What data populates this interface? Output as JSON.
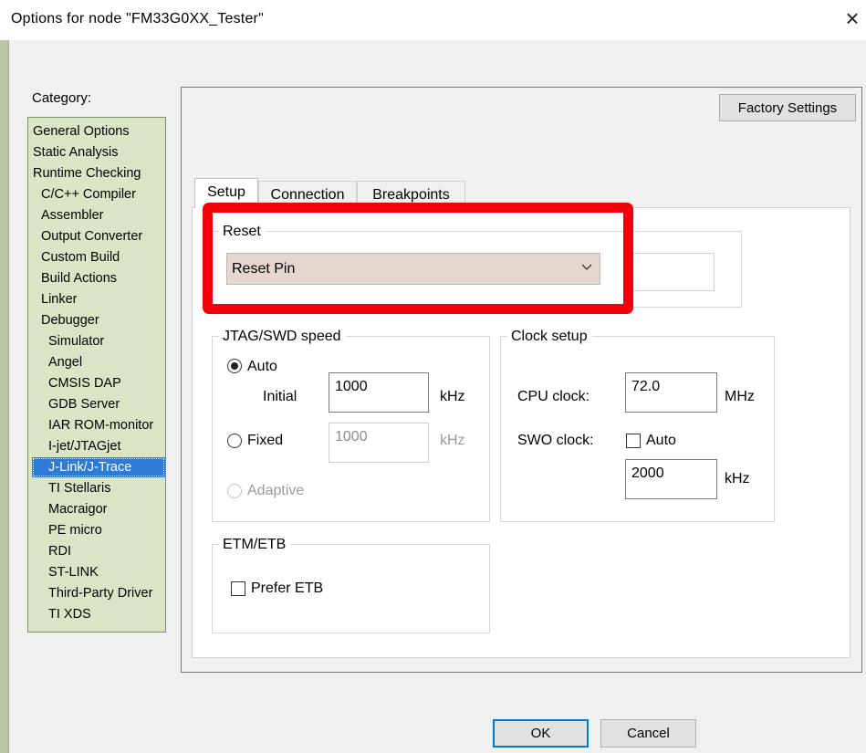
{
  "window": {
    "title": "Options for node \"FM33G0XX_Tester\"",
    "close_glyph": "×"
  },
  "category": {
    "label": "Category:",
    "items": [
      {
        "label": "General Options"
      },
      {
        "label": "Static Analysis"
      },
      {
        "label": "Runtime Checking"
      },
      {
        "label": "C/C++ Compiler"
      },
      {
        "label": "Assembler"
      },
      {
        "label": "Output Converter"
      },
      {
        "label": "Custom Build"
      },
      {
        "label": "Build Actions"
      },
      {
        "label": "Linker"
      },
      {
        "label": "Debugger"
      },
      {
        "label": "Simulator"
      },
      {
        "label": "Angel"
      },
      {
        "label": "CMSIS DAP"
      },
      {
        "label": "GDB Server"
      },
      {
        "label": "IAR ROM-monitor"
      },
      {
        "label": "I-jet/JTAGjet"
      },
      {
        "label": "J-Link/J-Trace"
      },
      {
        "label": "TI Stellaris"
      },
      {
        "label": "Macraigor"
      },
      {
        "label": "PE micro"
      },
      {
        "label": "RDI"
      },
      {
        "label": "ST-LINK"
      },
      {
        "label": "Third-Party Driver"
      },
      {
        "label": "TI XDS"
      }
    ],
    "selected": "J-Link/J-Trace"
  },
  "factory_button": "Factory Settings",
  "tabs": [
    {
      "label": "Setup",
      "active": true
    },
    {
      "label": "Connection",
      "active": false
    },
    {
      "label": "Breakpoints",
      "active": false
    }
  ],
  "reset": {
    "label": "Reset",
    "value": "Reset Pin"
  },
  "jtag": {
    "label": "JTAG/SWD speed",
    "auto_label": "Auto",
    "initial_label": "Initial",
    "initial_value": "1000",
    "initial_unit": "kHz",
    "fixed_label": "Fixed",
    "fixed_value": "1000",
    "fixed_unit": "kHz",
    "adaptive_label": "Adaptive",
    "selected": "Auto"
  },
  "clock": {
    "label": "Clock setup",
    "cpu_label": "CPU clock:",
    "cpu_value": "72.0",
    "cpu_unit": "MHz",
    "swo_label": "SWO clock:",
    "swo_auto_label": "Auto",
    "swo_auto_checked": false,
    "swo_value": "2000",
    "swo_unit": "kHz"
  },
  "etm": {
    "label": "ETM/ETB",
    "prefer_label": "Prefer ETB",
    "prefer_checked": false
  },
  "buttons": {
    "ok": "OK",
    "cancel": "Cancel"
  },
  "colors": {
    "highlight": "#f5000a",
    "selection": "#2f7ad7",
    "category_bg": "#d9e5c5"
  }
}
